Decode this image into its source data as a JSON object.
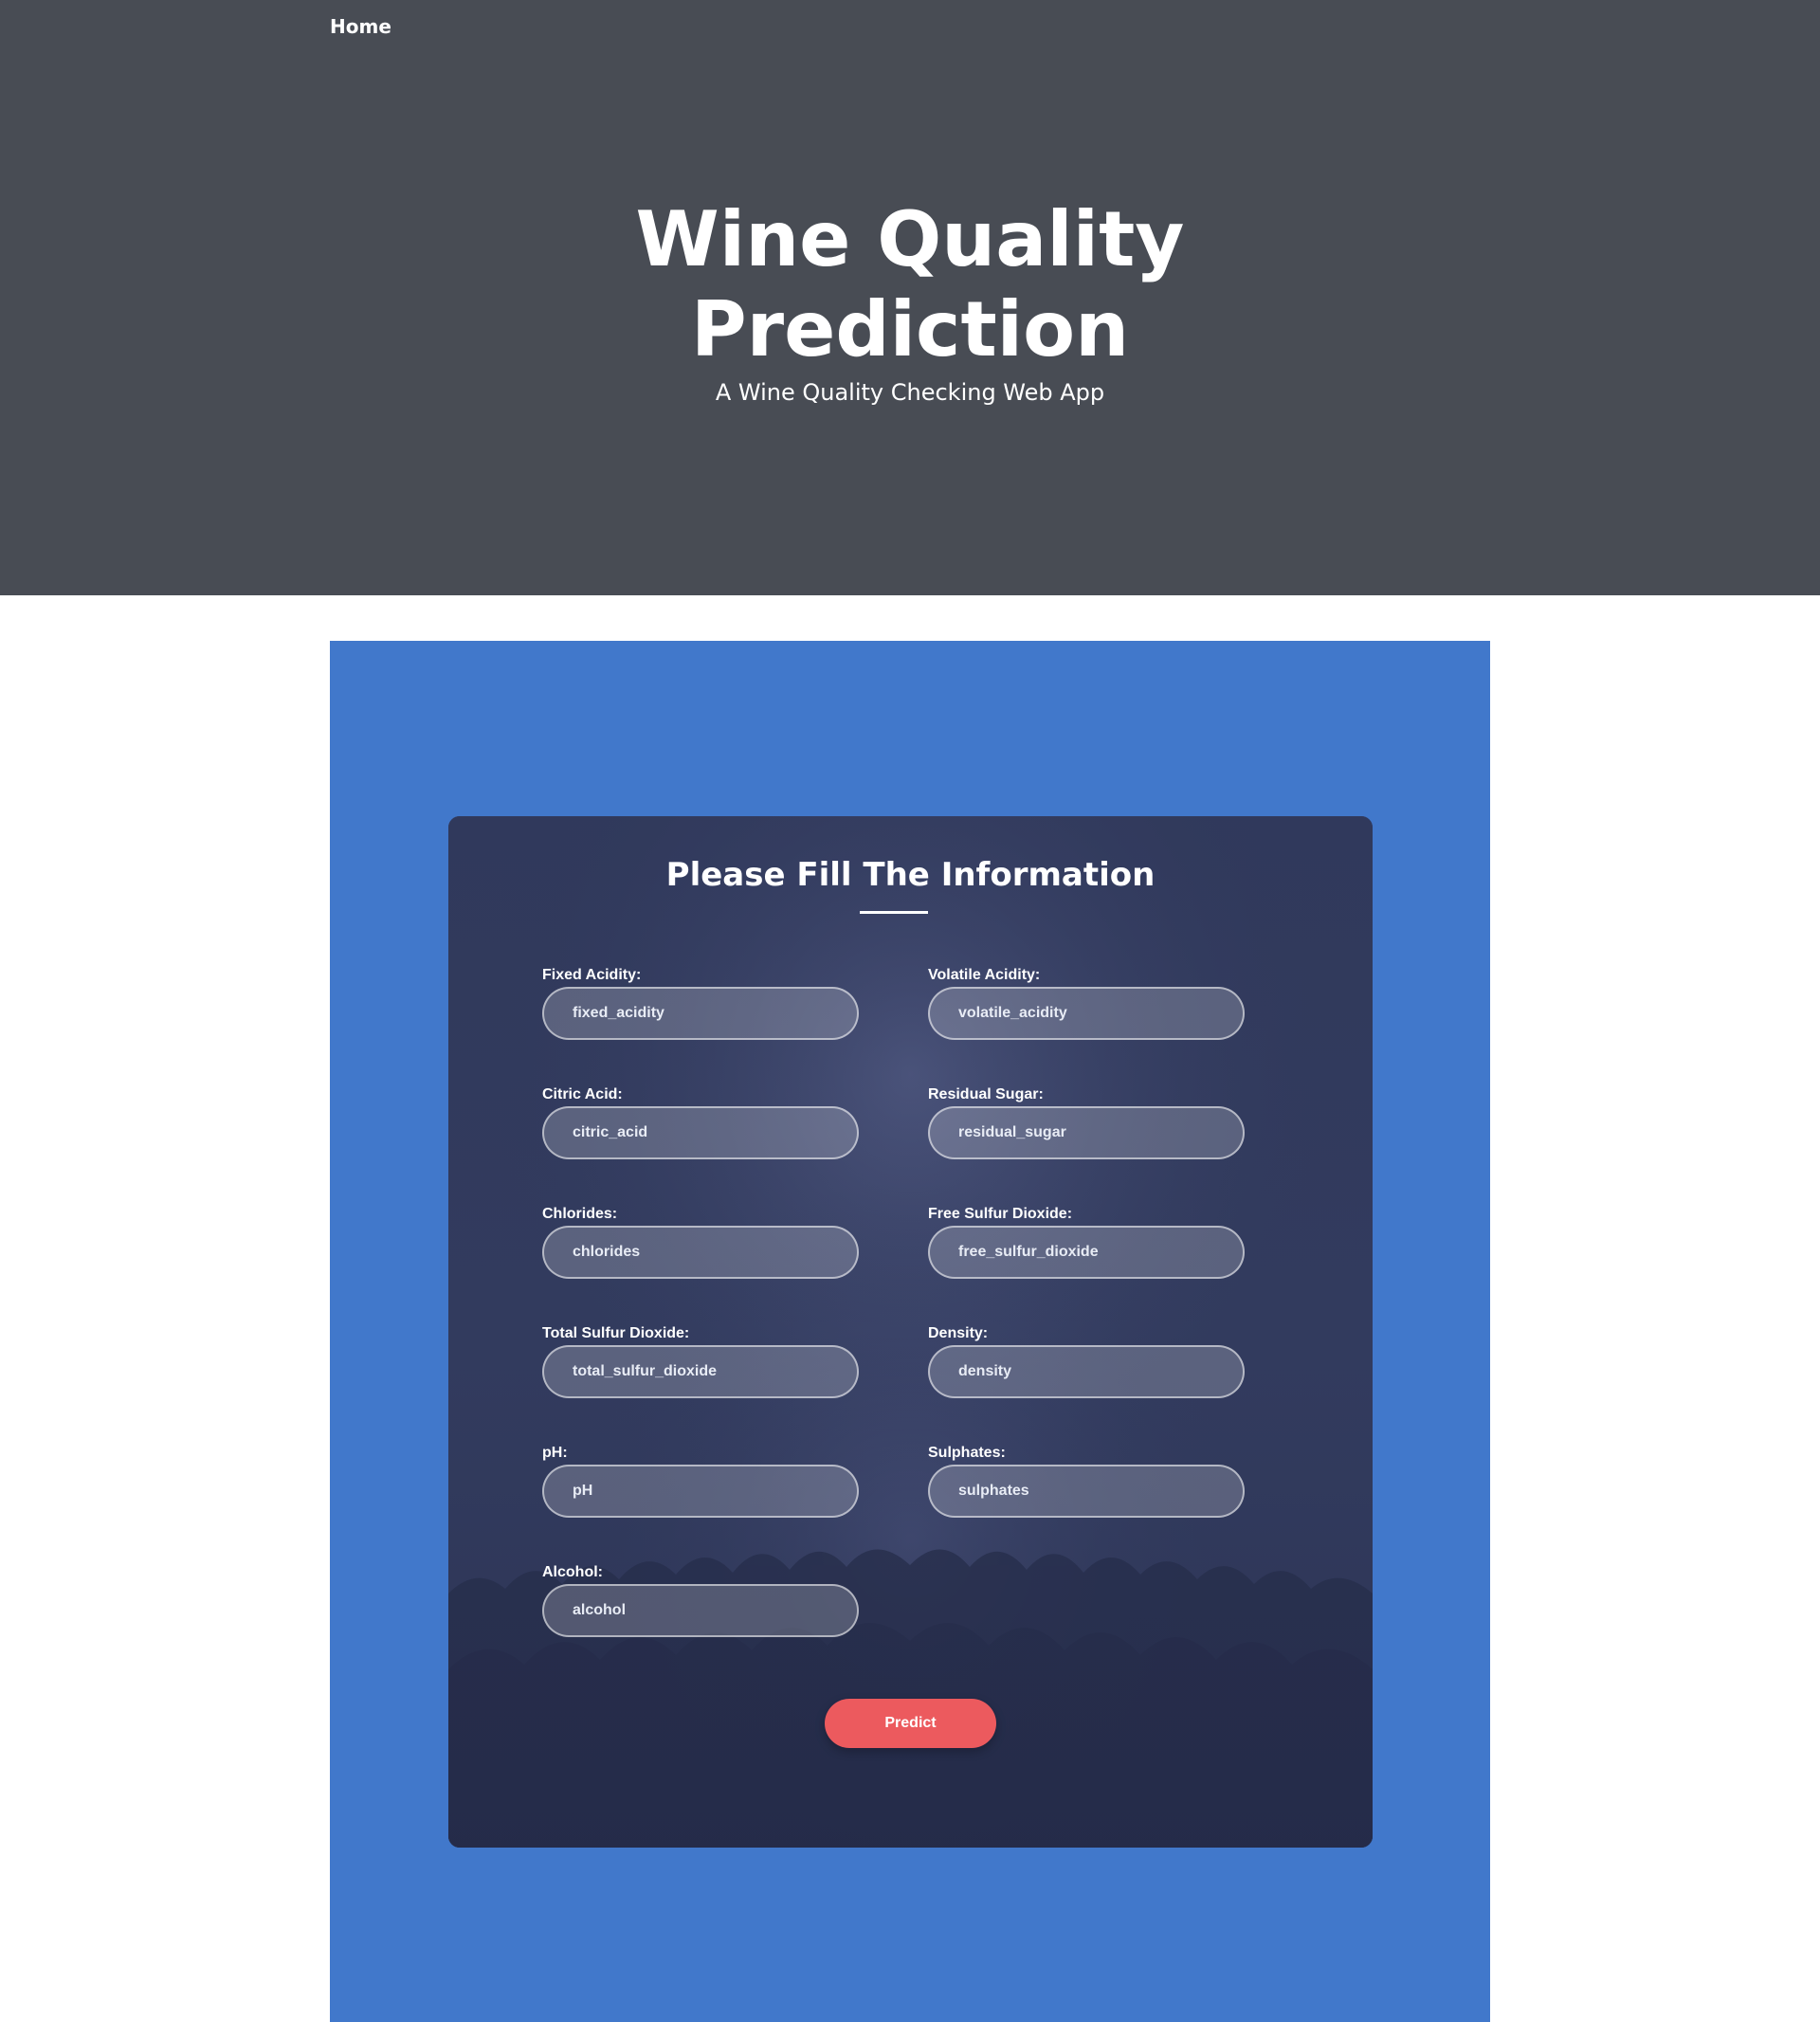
{
  "nav": {
    "home_label": "Home"
  },
  "hero": {
    "title_line1": "Wine Quality",
    "title_line2": "Prediction",
    "subtitle": "A Wine Quality Checking Web App"
  },
  "form": {
    "title": "Please Fill The Information",
    "fields": [
      {
        "label": "Fixed Acidity:",
        "placeholder": "fixed_acidity",
        "value": ""
      },
      {
        "label": "Volatile Acidity:",
        "placeholder": "volatile_acidity",
        "value": ""
      },
      {
        "label": "Citric Acid:",
        "placeholder": "citric_acid",
        "value": ""
      },
      {
        "label": "Residual Sugar:",
        "placeholder": "residual_sugar",
        "value": ""
      },
      {
        "label": "Chlorides:",
        "placeholder": "chlorides",
        "value": ""
      },
      {
        "label": "Free Sulfur Dioxide:",
        "placeholder": "free_sulfur_dioxide",
        "value": ""
      },
      {
        "label": "Total Sulfur Dioxide:",
        "placeholder": "total_sulfur_dioxide",
        "value": ""
      },
      {
        "label": "Density:",
        "placeholder": "density",
        "value": ""
      },
      {
        "label": "pH:",
        "placeholder": "pH",
        "value": ""
      },
      {
        "label": "Sulphates:",
        "placeholder": "sulphates",
        "value": ""
      },
      {
        "label": "Alcohol:",
        "placeholder": "alcohol",
        "value": ""
      }
    ],
    "submit_label": "Predict"
  },
  "colors": {
    "hero_bg": "#484c54",
    "section_bg": "#4178cb",
    "card_bg": "#323b5e",
    "button_bg": "#ec5a5e"
  }
}
